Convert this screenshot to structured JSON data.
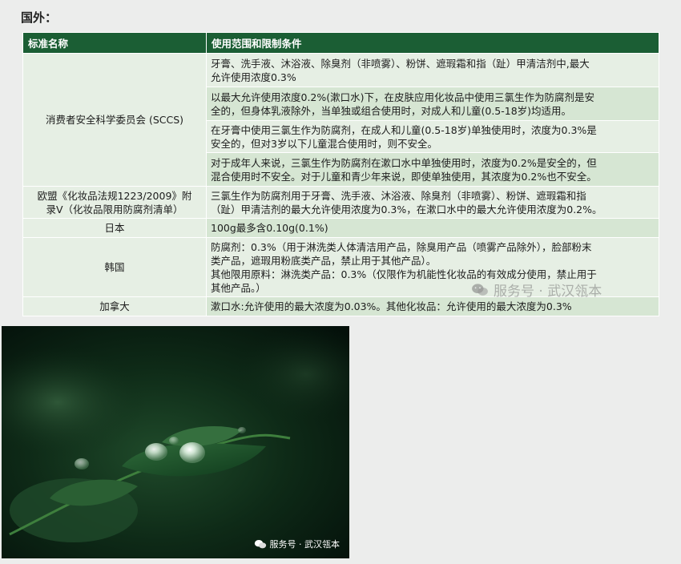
{
  "section": {
    "title": "国外："
  },
  "table": {
    "headers": [
      "标准名称",
      "使用范围和限制条件"
    ],
    "rows": [
      {
        "name": "消费者安全科学委员会 (SCCS)",
        "conditions": [
          [
            "牙膏、洗手液、沐浴液、除臭剂（非喷雾）、粉饼、遮瑕霜和指（趾）甲清洁剂中,最大",
            "允许使用浓度0.3%"
          ],
          [
            "以最大允许使用浓度0.2%(漱口水)下，在皮肤应用化妆品中使用三氯生作为防腐剂是安",
            "全的，但身体乳液除外，当单独或组合使用时，对成人和儿童(0.5-18岁)均适用。"
          ],
          [
            "在牙膏中使用三氯生作为防腐剂，在成人和儿童(0.5-18岁)单独使用时，浓度为0.3%是",
            "安全的，但对3岁以下儿童混合使用时，则不安全。"
          ],
          [
            "对于成年人来说，三氯生作为防腐剂在漱口水中单独使用时，浓度为0.2%是安全的，但",
            "混合使用时不安全。对于儿童和青少年来说，即使单独使用，其浓度为0.2%也不安全。"
          ]
        ]
      },
      {
        "name": [
          "欧盟《化妆品法规1223/2009》附",
          "录V（化妆品限用防腐剂清单）"
        ],
        "conditions": [
          [
            "三氯生作为防腐剂用于牙膏、洗手液、沐浴液、除臭剂（非喷雾）、粉饼、遮瑕霜和指",
            "（趾）甲清洁剂的最大允许使用浓度为0.3%，在漱口水中的最大允许使用浓度为0.2%。"
          ]
        ]
      },
      {
        "name": "日本",
        "conditions": [
          [
            "100g最多含0.10g(0.1%)"
          ]
        ]
      },
      {
        "name": "韩国",
        "conditions": [
          [
            "防腐剂：0.3%（用于淋洗类人体清洁用产品，除臭用产品（喷雾产品除外），脸部粉末",
            "类产品，遮瑕用粉底类产品，禁止用于其他产品）。",
            "其他限用原料：淋洗类产品：0.3%（仅限作为机能性化妆品的有效成分使用，禁止用于",
            "其他产品。）"
          ]
        ]
      },
      {
        "name": "加拿大",
        "conditions": [
          [
            "漱口水:允许使用的最大浓度为0.03%。其他化妆品：允许使用的最大浓度为0.3%"
          ]
        ]
      }
    ]
  },
  "watermark": {
    "text": "服务号 · 武汉瓴本",
    "icon": "wechat-icon"
  },
  "photo": {
    "caption": "服务号 · 武汉瓴本",
    "icon": "wechat-icon"
  },
  "colors": {
    "header_bg": "#1b5e34",
    "row_light": "#e6efe4",
    "row_dark": "#d6e6d3"
  }
}
